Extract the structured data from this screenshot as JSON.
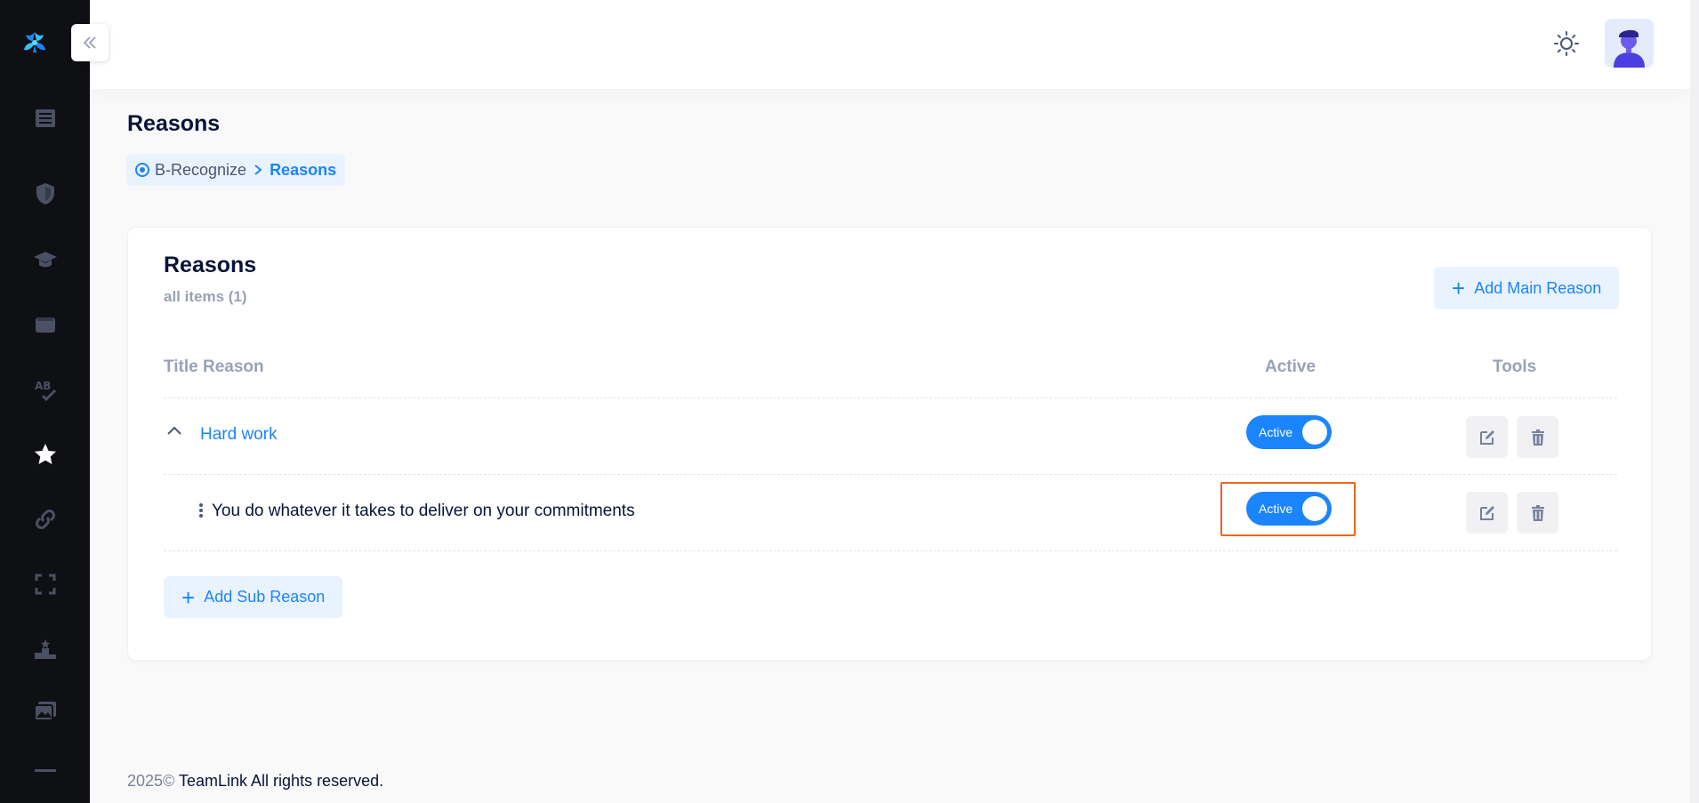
{
  "sidebar": {
    "logo": "teamlink-logo",
    "items": [
      {
        "icon": "newspaper-icon"
      },
      {
        "icon": "shield-icon"
      },
      {
        "icon": "graduation-cap-icon"
      },
      {
        "icon": "wallet-icon"
      },
      {
        "icon": "spellcheck-icon"
      },
      {
        "icon": "star-icon",
        "active": true
      },
      {
        "icon": "link-icon"
      },
      {
        "icon": "fullscreen-icon"
      },
      {
        "icon": "podium-icon"
      },
      {
        "icon": "gallery-icon"
      },
      {
        "icon": "minus-icon"
      }
    ]
  },
  "header": {
    "theme_icon": "sun-icon",
    "avatar": "user-avatar"
  },
  "page": {
    "title": "Reasons",
    "breadcrumb": {
      "home": "B-Recognize",
      "current": "Reasons"
    }
  },
  "card": {
    "title": "Reasons",
    "subtitle": "all items (1)",
    "add_main_label": "Add Main Reason",
    "columns": {
      "title": "Title Reason",
      "active": "Active",
      "tools": "Tools"
    },
    "rows": [
      {
        "title": "Hard work",
        "type": "main",
        "expanded": true,
        "active_label": "Active",
        "active": true
      },
      {
        "title": "You do whatever it takes to deliver on your commitments",
        "type": "sub",
        "active_label": "Active",
        "active": true
      }
    ],
    "add_sub_label": "Add Sub Reason"
  },
  "footer": {
    "year": "2025©",
    "text": "TeamLink All rights reserved."
  },
  "colors": {
    "primary": "#1b84ff",
    "sidebar_bg": "#0f1014",
    "highlight": "#e8671c"
  }
}
